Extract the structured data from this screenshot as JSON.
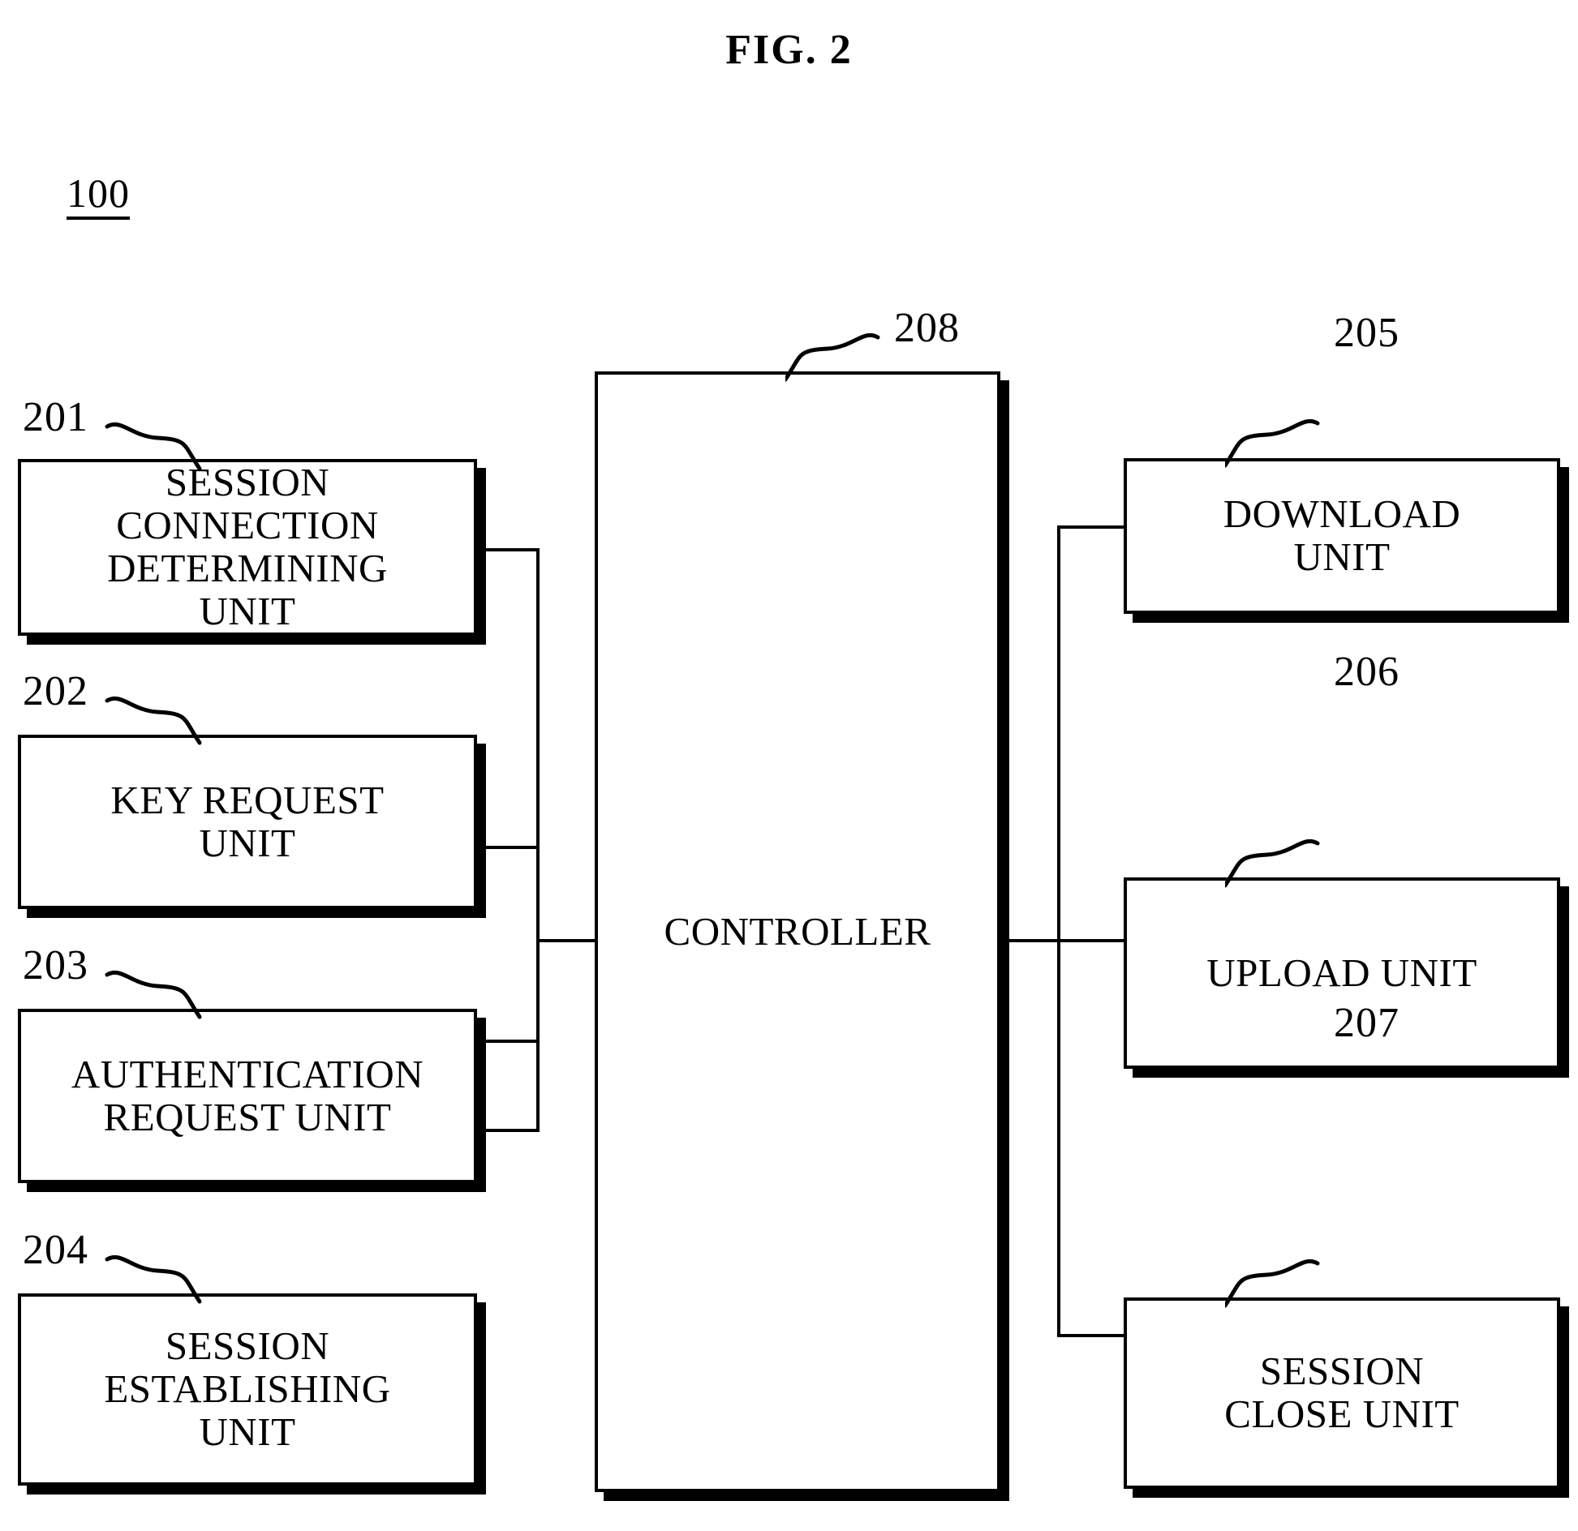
{
  "figure": {
    "title": "FIG.  2",
    "system_numeral": "100"
  },
  "blocks": {
    "left": [
      {
        "numeral": "201",
        "label": "SESSION\nCONNECTION\nDETERMINING\nUNIT"
      },
      {
        "numeral": "202",
        "label": "KEY REQUEST\nUNIT"
      },
      {
        "numeral": "203",
        "label": "AUTHENTICATION\nREQUEST UNIT"
      },
      {
        "numeral": "204",
        "label": "SESSION\nESTABLISHING\nUNIT"
      }
    ],
    "center": {
      "numeral": "208",
      "label": "CONTROLLER"
    },
    "right": [
      {
        "numeral": "205",
        "label": "DOWNLOAD\nUNIT"
      },
      {
        "numeral": "206",
        "label": "UPLOAD UNIT"
      },
      {
        "numeral": "207",
        "label": "SESSION\nCLOSE UNIT"
      }
    ]
  },
  "colors": {
    "ink": "#000000",
    "paper": "#ffffff"
  }
}
